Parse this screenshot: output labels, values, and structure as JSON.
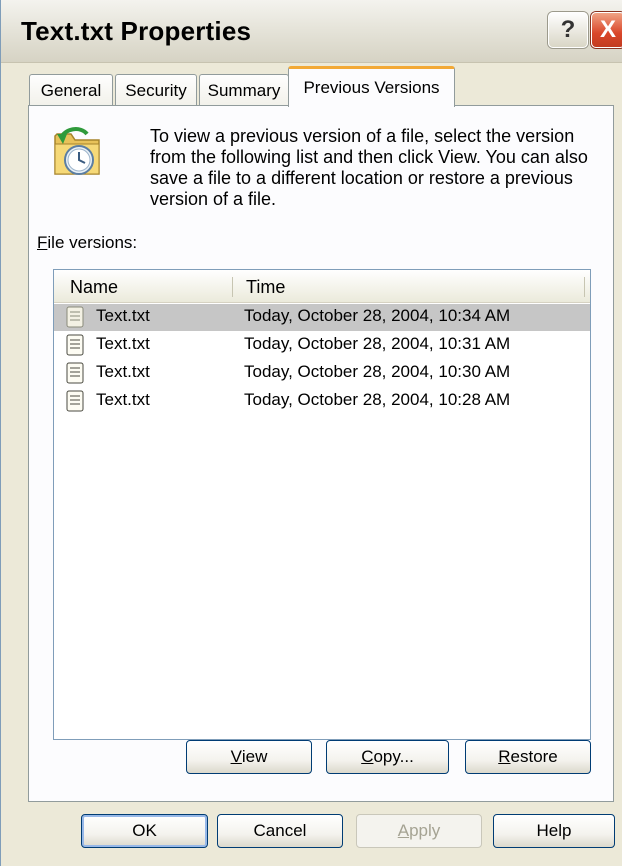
{
  "window": {
    "title": "Text.txt Properties"
  },
  "titlebar": {
    "help_label": "?",
    "close_label": "X"
  },
  "tabs": [
    {
      "label": "General",
      "active": false
    },
    {
      "label": "Security",
      "active": false
    },
    {
      "label": "Summary",
      "active": false
    },
    {
      "label": "Previous Versions",
      "active": true
    }
  ],
  "panel": {
    "description": "To view a previous version of a file, select the version from the following list and then click View.  You can also save a file to a different location or restore a previous version of a file.",
    "versions_label_mnemonic": "F",
    "versions_label_rest": "ile versions:",
    "columns": [
      "Name",
      "Time"
    ],
    "rows": [
      {
        "name": "Text.txt",
        "time": "Today, October 28, 2004, 10:34 AM",
        "selected": true
      },
      {
        "name": "Text.txt",
        "time": "Today, October 28, 2004, 10:31 AM",
        "selected": false
      },
      {
        "name": "Text.txt",
        "time": "Today, October 28, 2004, 10:30 AM",
        "selected": false
      },
      {
        "name": "Text.txt",
        "time": "Today, October 28, 2004, 10:28 AM",
        "selected": false
      }
    ],
    "view_mnemonic": "V",
    "view_rest": "iew",
    "copy_mnemonic": "C",
    "copy_rest": "opy...",
    "restore_mnemonic": "R",
    "restore_rest": "estore"
  },
  "footer": {
    "ok_label": "OK",
    "cancel_label": "Cancel",
    "apply_mnemonic": "A",
    "apply_rest": "pply",
    "help_label": "Help"
  },
  "colors": {
    "tab_highlight": "#f2a936",
    "close_button": "#d9462a",
    "dialog_bg": "#ece9d8"
  },
  "icons": [
    "previous-versions-folder-icon",
    "text-file-icon",
    "help-icon",
    "close-icon"
  ]
}
